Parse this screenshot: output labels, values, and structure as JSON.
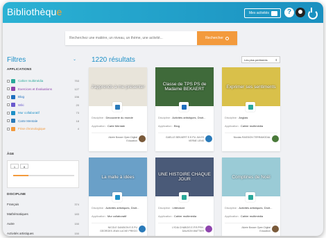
{
  "header": {
    "brand": "Bibliothèqu",
    "brand_last": "e",
    "my_activities": "Mes activités"
  },
  "search": {
    "placeholder": "Recherchez une matière, un niveau, un thème, une activité...",
    "button": "Rechercher"
  },
  "sidebar": {
    "title": "Filtres",
    "applications_title": "APPLICATIONS",
    "applications": [
      {
        "label": "Cahier multimédia",
        "count": "753",
        "color": "#2aa89a"
      },
      {
        "label": "Exercices et Évaluations",
        "count": "127",
        "color": "#8e44ad"
      },
      {
        "label": "Blog",
        "count": "156",
        "color": "#1e6fbf"
      },
      {
        "label": "Wiki",
        "count": "20",
        "color": "#6a5acd"
      },
      {
        "label": "Mur collaboratif",
        "count": "73",
        "color": "#1e90c7"
      },
      {
        "label": "Carte Mentale",
        "count": "18",
        "color": "#2a7ab9"
      },
      {
        "label": "Frise chronologique",
        "count": "4",
        "color": "#f39a3c"
      }
    ],
    "age_title": "ÂGE",
    "age": {
      "min": "1",
      "max": "8",
      "fill_fraction": 0.25
    },
    "discipline_title": "DISCIPLINE",
    "disciplines": [
      {
        "label": "Français",
        "count": "374"
      },
      {
        "label": "Mathématiques",
        "count": "183"
      },
      {
        "label": "Autre",
        "count": "150"
      },
      {
        "label": "Activités artistiques",
        "count": "150"
      },
      {
        "label": "Apprentissage de la lecture",
        "count": "142"
      }
    ]
  },
  "main": {
    "results": "1220 résultats",
    "sort": "Les plus pertinents",
    "discipline_label": "Discipline :",
    "application_label": "Application :",
    "cards": [
      {
        "title": "J'apprends à me présenter",
        "discipline": "Découverte du monde",
        "application": "Carte Mentale",
        "author": "Alizée Bosser Open Digital Education",
        "thumb_color": "#e8e4da",
        "badge_color": "#2a7ab9",
        "avatar_color": "#7a5a3a"
      },
      {
        "title": "Classe de TPS PS de Madame BEKAERT",
        "discipline": "Activités artistiques, Droit...",
        "application": "Blog",
        "author": "GAELLE BEKAERT E.E.PU JULES VERNE LENS",
        "thumb_color": "#3f6a3a",
        "badge_color": "#1e6fbf",
        "avatar_color": "#2a7ab9"
      },
      {
        "title": "Exprimer ses sentiments",
        "discipline": "Anglais",
        "application": "Cahier multimédia",
        "author": "Nicolas RASSION TERRAMODAL",
        "thumb_color": "#d9c04a",
        "badge_color": "#2aa89a",
        "avatar_color": "#4a7a3a"
      },
      {
        "title": "La malle à idées",
        "discipline": "Activités artistiques, Droit...",
        "application": "Mur collaboratif",
        "author": "NICOLE DANSION E.E.PU GEORGES JEAN LUCKE PREGO",
        "thumb_color": "#6aa0c8",
        "badge_color": "#1e90c7",
        "avatar_color": "#2a7ab9"
      },
      {
        "title": "UNE HISTOIRE CHAQUE JOUR",
        "discipline": "Littérature",
        "application": "Cahier multimédia",
        "author": "LYDIA CHABOIS E.P.R.PRIV. DAUSON WATTIER",
        "thumb_color": "#4a5a78",
        "badge_color": "#2aa89a",
        "avatar_color": "#8e44ad"
      },
      {
        "title": "Comptines de Noël",
        "discipline": "Activités artistiques, Droit...",
        "application": "Cahier multimédia",
        "author": "Alizée Bosser Open Digital Education",
        "thumb_color": "#9acbd6",
        "badge_color": "#2aa89a",
        "avatar_color": "#7a5a3a"
      }
    ]
  },
  "icons": {
    "help": "?",
    "search": "search-icon",
    "user": "user-icon",
    "power": "power-icon"
  }
}
